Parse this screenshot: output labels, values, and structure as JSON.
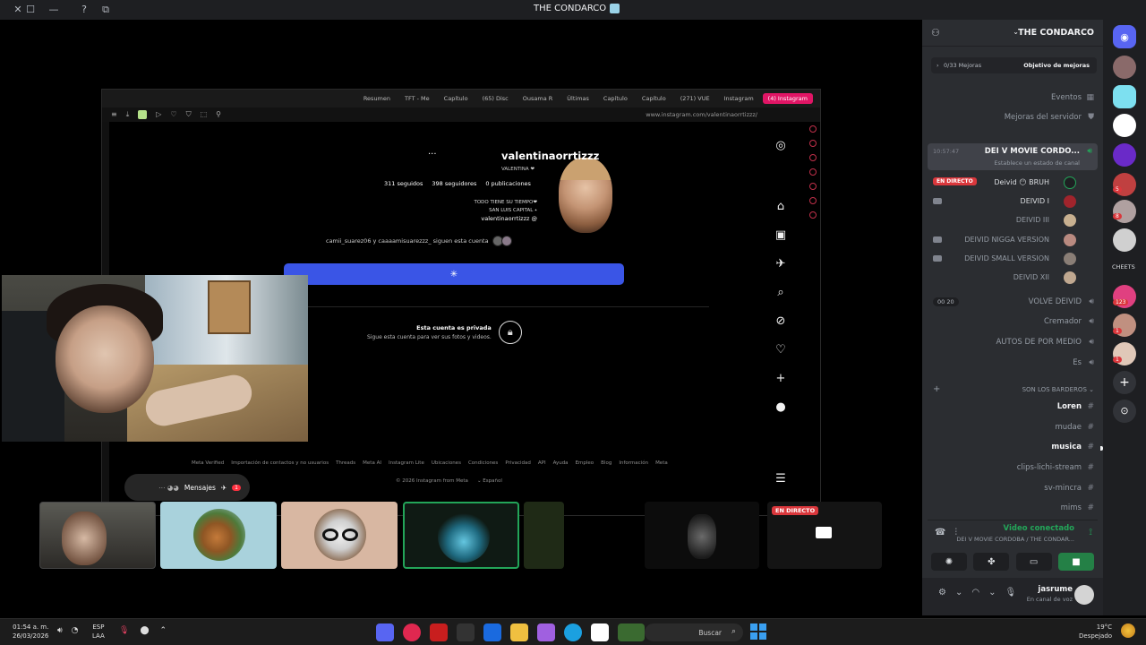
{
  "window": {
    "title": "THE CONDARCO"
  },
  "browser": {
    "tabs": [
      "(4) Instagram",
      "Instagram",
      "(271) VUE",
      "Capítulo",
      "Capítulo",
      "Últimas",
      "Ousama R",
      "(65) Disc",
      "Capítulo",
      "TFT - Me",
      "Resumen"
    ],
    "url": "www.instagram.com/valentinaorrtizzz/"
  },
  "instagram": {
    "username": "valentinaorrtizzz",
    "display_name": "VALENTINA ❤",
    "stats": {
      "posts": "0 publicaciones",
      "followers": "398 seguidores",
      "following": "311 seguidos"
    },
    "bio_lines": [
      "TODO TIENE SU TIEMPO❤",
      "SAN LUIS CAPITAL ⭑"
    ],
    "threads_handle": "valentinaorrtizzz",
    "followed_by": "camii_suarez06 y caaaamisuarezzz_ siguen esta cuenta",
    "private_title": "Esta cuenta es privada",
    "private_desc": "Sigue esta cuenta para ver sus fotos y videos.",
    "footer_links": [
      "Meta",
      "Información",
      "Blog",
      "Empleo",
      "Ayuda",
      "API",
      "Privacidad",
      "Condiciones",
      "Ubicaciones",
      "Instagram Lite",
      "Meta AI",
      "Threads",
      "Importación de contactos y no usuarios",
      "Meta Verified"
    ],
    "language": "Español",
    "copyright": "© 2026 Instagram from Meta",
    "messages_label": "Mensajes",
    "messages_badge": "1"
  },
  "stream": {
    "live_label": "EN DIRECTO"
  },
  "discord": {
    "server_name": "THE CONDARCO",
    "boost_goal": "Objetivo de mejoras",
    "boost_count": "0/33 Mejoras",
    "top_items": [
      {
        "label": "Eventos",
        "icon": "calendar-icon"
      },
      {
        "label": "Mejoras del servidor",
        "icon": "boost-icon"
      }
    ],
    "active_voice": {
      "name": "DEI V MOVIE CORDO...",
      "time": "10:57:47",
      "status": "Establece un estado de canal"
    },
    "voice_users": [
      {
        "name": "Deivid 😶 BRUH",
        "tag": "EN DIRECTO"
      },
      {
        "name": "DEIVID I",
        "tag": ""
      },
      {
        "name": "DEIVID III",
        "tag": ""
      },
      {
        "name": "DEIVID NIGGA VERSION",
        "tag": ""
      },
      {
        "name": "DEIVID SMALL VERSION",
        "tag": ""
      },
      {
        "name": "DEIVID XII",
        "tag": ""
      }
    ],
    "voice_channels": [
      {
        "label": "VOLVE DEIVID",
        "count": "00 20"
      },
      {
        "label": "Cremador",
        "count": ""
      },
      {
        "label": "AUTOS DE POR MEDIO",
        "count": ""
      },
      {
        "label": "Es",
        "count": ""
      }
    ],
    "category": "SON LOS BARDEROS",
    "text_channels": [
      {
        "label": "Loren",
        "bold": true
      },
      {
        "label": "mudae",
        "bold": false
      },
      {
        "label": "musica",
        "bold": true
      },
      {
        "label": "clips-lichi-stream",
        "bold": false
      },
      {
        "label": "sv-mincra",
        "bold": false
      },
      {
        "label": "mims",
        "bold": false
      }
    ],
    "voice_panel": {
      "title": "Video conectado",
      "subtitle": "DEI V MOVIE CORDOBA / THE CONDAR..."
    },
    "user": {
      "name": "jasrume",
      "status": "En canal de voz"
    },
    "guild_badges": [
      "5",
      "8",
      "123",
      "1",
      "1"
    ],
    "guild_label": "CHEETS"
  },
  "taskbar": {
    "time": "01:54 a. m.",
    "date": "26/03/2026",
    "lang_top": "ESP",
    "lang_bottom": "LAA",
    "search": "Buscar",
    "weather_temp": "19°C",
    "weather_desc": "Despejado"
  }
}
